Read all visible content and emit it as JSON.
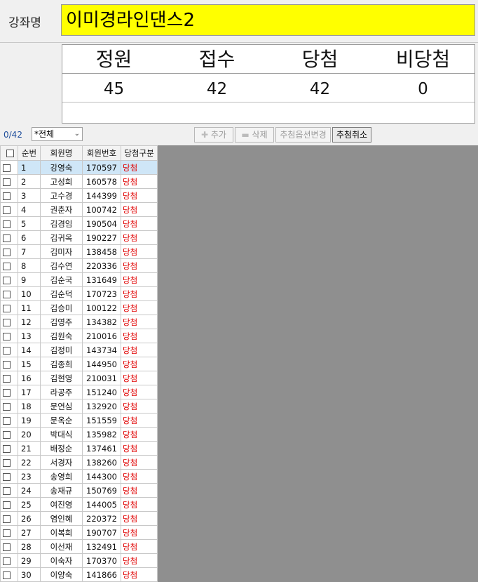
{
  "course": {
    "label": "강좌명",
    "name": "이미경라인댄스2"
  },
  "stats": {
    "headers": [
      "정원",
      "접수",
      "당첨",
      "비당첨"
    ],
    "values": [
      "45",
      "42",
      "42",
      "0"
    ]
  },
  "toolbar": {
    "count": "0/42",
    "filter_value": "*전체",
    "add_label": "추가",
    "delete_label": "삭제",
    "option_change_label": "추첨옵션변경",
    "cancel_label": "추첨취소"
  },
  "table": {
    "columns": [
      "순번",
      "회원명",
      "회원번호",
      "당첨구분"
    ],
    "rows": [
      {
        "seq": "1",
        "name": "강영숙",
        "num": "170597",
        "status": "당첨"
      },
      {
        "seq": "2",
        "name": "고성희",
        "num": "160578",
        "status": "당첨"
      },
      {
        "seq": "3",
        "name": "고수경",
        "num": "144399",
        "status": "당첨"
      },
      {
        "seq": "4",
        "name": "권춘자",
        "num": "100742",
        "status": "당첨"
      },
      {
        "seq": "5",
        "name": "김경임",
        "num": "190504",
        "status": "당첨"
      },
      {
        "seq": "6",
        "name": "김귀옥",
        "num": "190227",
        "status": "당첨"
      },
      {
        "seq": "7",
        "name": "김미자",
        "num": "138458",
        "status": "당첨"
      },
      {
        "seq": "8",
        "name": "김수연",
        "num": "220336",
        "status": "당첨"
      },
      {
        "seq": "9",
        "name": "김순국",
        "num": "131649",
        "status": "당첨"
      },
      {
        "seq": "10",
        "name": "김순덕",
        "num": "170723",
        "status": "당첨"
      },
      {
        "seq": "11",
        "name": "김승미",
        "num": "100122",
        "status": "당첨"
      },
      {
        "seq": "12",
        "name": "김영주",
        "num": "134382",
        "status": "당첨"
      },
      {
        "seq": "13",
        "name": "김원숙",
        "num": "210016",
        "status": "당첨"
      },
      {
        "seq": "14",
        "name": "김정미",
        "num": "143734",
        "status": "당첨"
      },
      {
        "seq": "15",
        "name": "김종희",
        "num": "144950",
        "status": "당첨"
      },
      {
        "seq": "16",
        "name": "김현영",
        "num": "210031",
        "status": "당첨"
      },
      {
        "seq": "17",
        "name": "라공주",
        "num": "151240",
        "status": "당첨"
      },
      {
        "seq": "18",
        "name": "문연심",
        "num": "132920",
        "status": "당첨"
      },
      {
        "seq": "19",
        "name": "문옥순",
        "num": "151559",
        "status": "당첨"
      },
      {
        "seq": "20",
        "name": "박대식",
        "num": "135982",
        "status": "당첨"
      },
      {
        "seq": "21",
        "name": "배정순",
        "num": "137461",
        "status": "당첨"
      },
      {
        "seq": "22",
        "name": "서경자",
        "num": "138260",
        "status": "당첨"
      },
      {
        "seq": "23",
        "name": "송영희",
        "num": "144300",
        "status": "당첨"
      },
      {
        "seq": "24",
        "name": "송재규",
        "num": "150769",
        "status": "당첨"
      },
      {
        "seq": "25",
        "name": "여진영",
        "num": "144005",
        "status": "당첨"
      },
      {
        "seq": "26",
        "name": "염인혜",
        "num": "220372",
        "status": "당첨"
      },
      {
        "seq": "27",
        "name": "이복희",
        "num": "190707",
        "status": "당첨"
      },
      {
        "seq": "28",
        "name": "이선재",
        "num": "132491",
        "status": "당첨"
      },
      {
        "seq": "29",
        "name": "이숙자",
        "num": "170370",
        "status": "당첨"
      },
      {
        "seq": "30",
        "name": "이양숙",
        "num": "141866",
        "status": "당첨"
      }
    ]
  },
  "colors": {
    "course_bg": "#ffff00",
    "status": "#e00000",
    "selected_row": "#cfe6f7",
    "empty_area": "#8f8f8f"
  }
}
